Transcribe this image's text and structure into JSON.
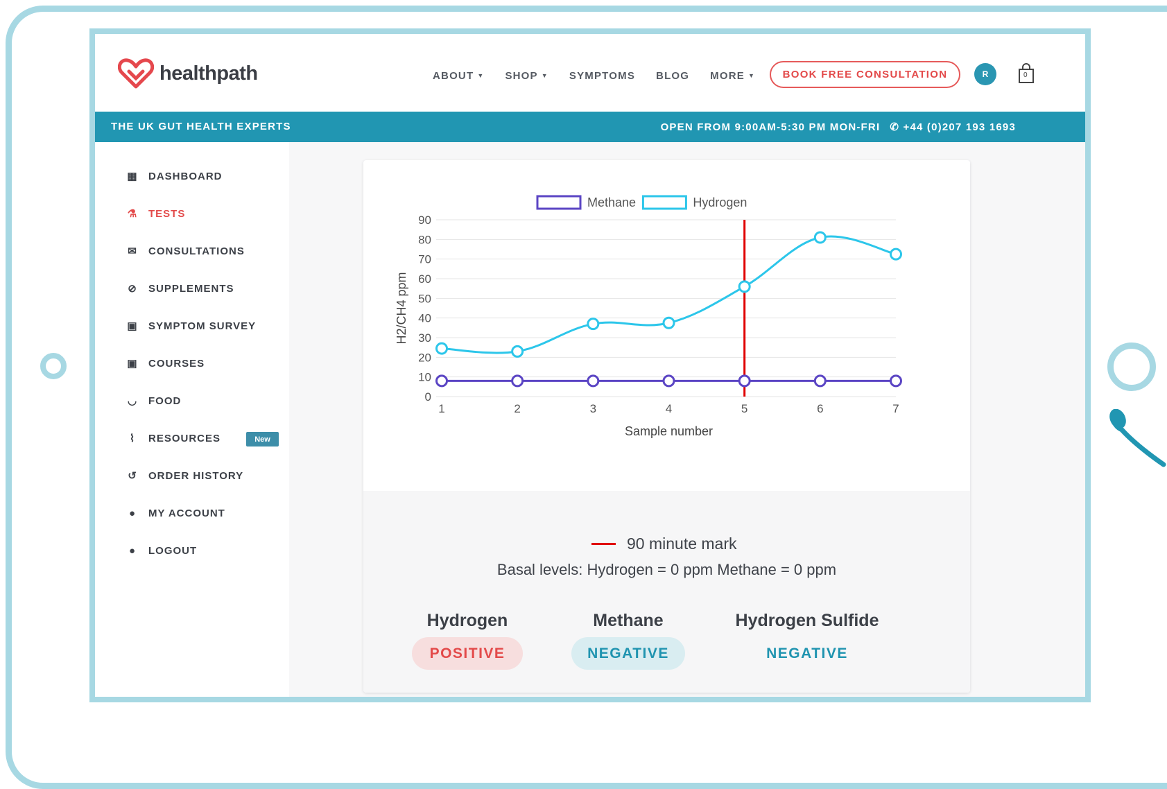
{
  "brand": {
    "name": "healthpath"
  },
  "nav": {
    "items": [
      {
        "label": "ABOUT",
        "dropdown": true
      },
      {
        "label": "SHOP",
        "dropdown": true
      },
      {
        "label": "SYMPTOMS",
        "dropdown": false
      },
      {
        "label": "BLOG",
        "dropdown": false
      },
      {
        "label": "MORE",
        "dropdown": true
      }
    ],
    "cta_label": "BOOK FREE CONSULTATION",
    "avatar_initial": "R",
    "cart_count": "0"
  },
  "banner": {
    "tagline": "THE UK GUT HEALTH EXPERTS",
    "hours": "OPEN FROM 9:00AM-5:30 PM MON-FRI",
    "phone": "+44 (0)207 193 1693"
  },
  "sidebar": {
    "items": [
      {
        "label": "DASHBOARD",
        "icon": "dashboard-icon",
        "active": false
      },
      {
        "label": "TESTS",
        "icon": "flask-icon",
        "active": true
      },
      {
        "label": "CONSULTATIONS",
        "icon": "chat-icon",
        "active": false
      },
      {
        "label": "SUPPLEMENTS",
        "icon": "pill-icon",
        "active": false
      },
      {
        "label": "SYMPTOM SURVEY",
        "icon": "clipboard-icon",
        "active": false
      },
      {
        "label": "COURSES",
        "icon": "clipboard-icon",
        "active": false
      },
      {
        "label": "FOOD",
        "icon": "bowl-icon",
        "active": false
      },
      {
        "label": "RESOURCES",
        "icon": "paperclip-icon",
        "active": false,
        "badge": "New"
      },
      {
        "label": "ORDER HISTORY",
        "icon": "history-icon",
        "active": false
      },
      {
        "label": "MY ACCOUNT",
        "icon": "user-icon",
        "active": false
      },
      {
        "label": "LOGOUT",
        "icon": "user-icon",
        "active": false
      }
    ]
  },
  "chart_data": {
    "type": "line",
    "x": [
      1,
      2,
      3,
      4,
      5,
      6,
      7
    ],
    "series": [
      {
        "name": "Methane",
        "values": [
          8,
          8,
          8,
          8,
          8,
          8,
          8
        ],
        "color": "#5b45c4"
      },
      {
        "name": "Hydrogen",
        "values": [
          24.5,
          23,
          37,
          37.5,
          56,
          81,
          72.5
        ],
        "color": "#2cc6ea"
      }
    ],
    "xlabel": "Sample number",
    "ylabel": "H2/CH4 ppm",
    "ylim": [
      0,
      90
    ],
    "yticks": [
      0,
      10,
      20,
      30,
      40,
      50,
      60,
      70,
      80,
      90
    ],
    "vertical_marker": {
      "x": 5,
      "color": "#e00000"
    },
    "legend_position": "top",
    "grid": true
  },
  "results": {
    "marker_label": "90 minute mark",
    "basal_text": "Basal levels: Hydrogen = 0 ppm Methane = 0 ppm",
    "items": [
      {
        "title": "Hydrogen",
        "status": "POSITIVE"
      },
      {
        "title": "Methane",
        "status": "NEGATIVE"
      },
      {
        "title": "Hydrogen Sulfide",
        "status": "NEGATIVE"
      }
    ]
  }
}
